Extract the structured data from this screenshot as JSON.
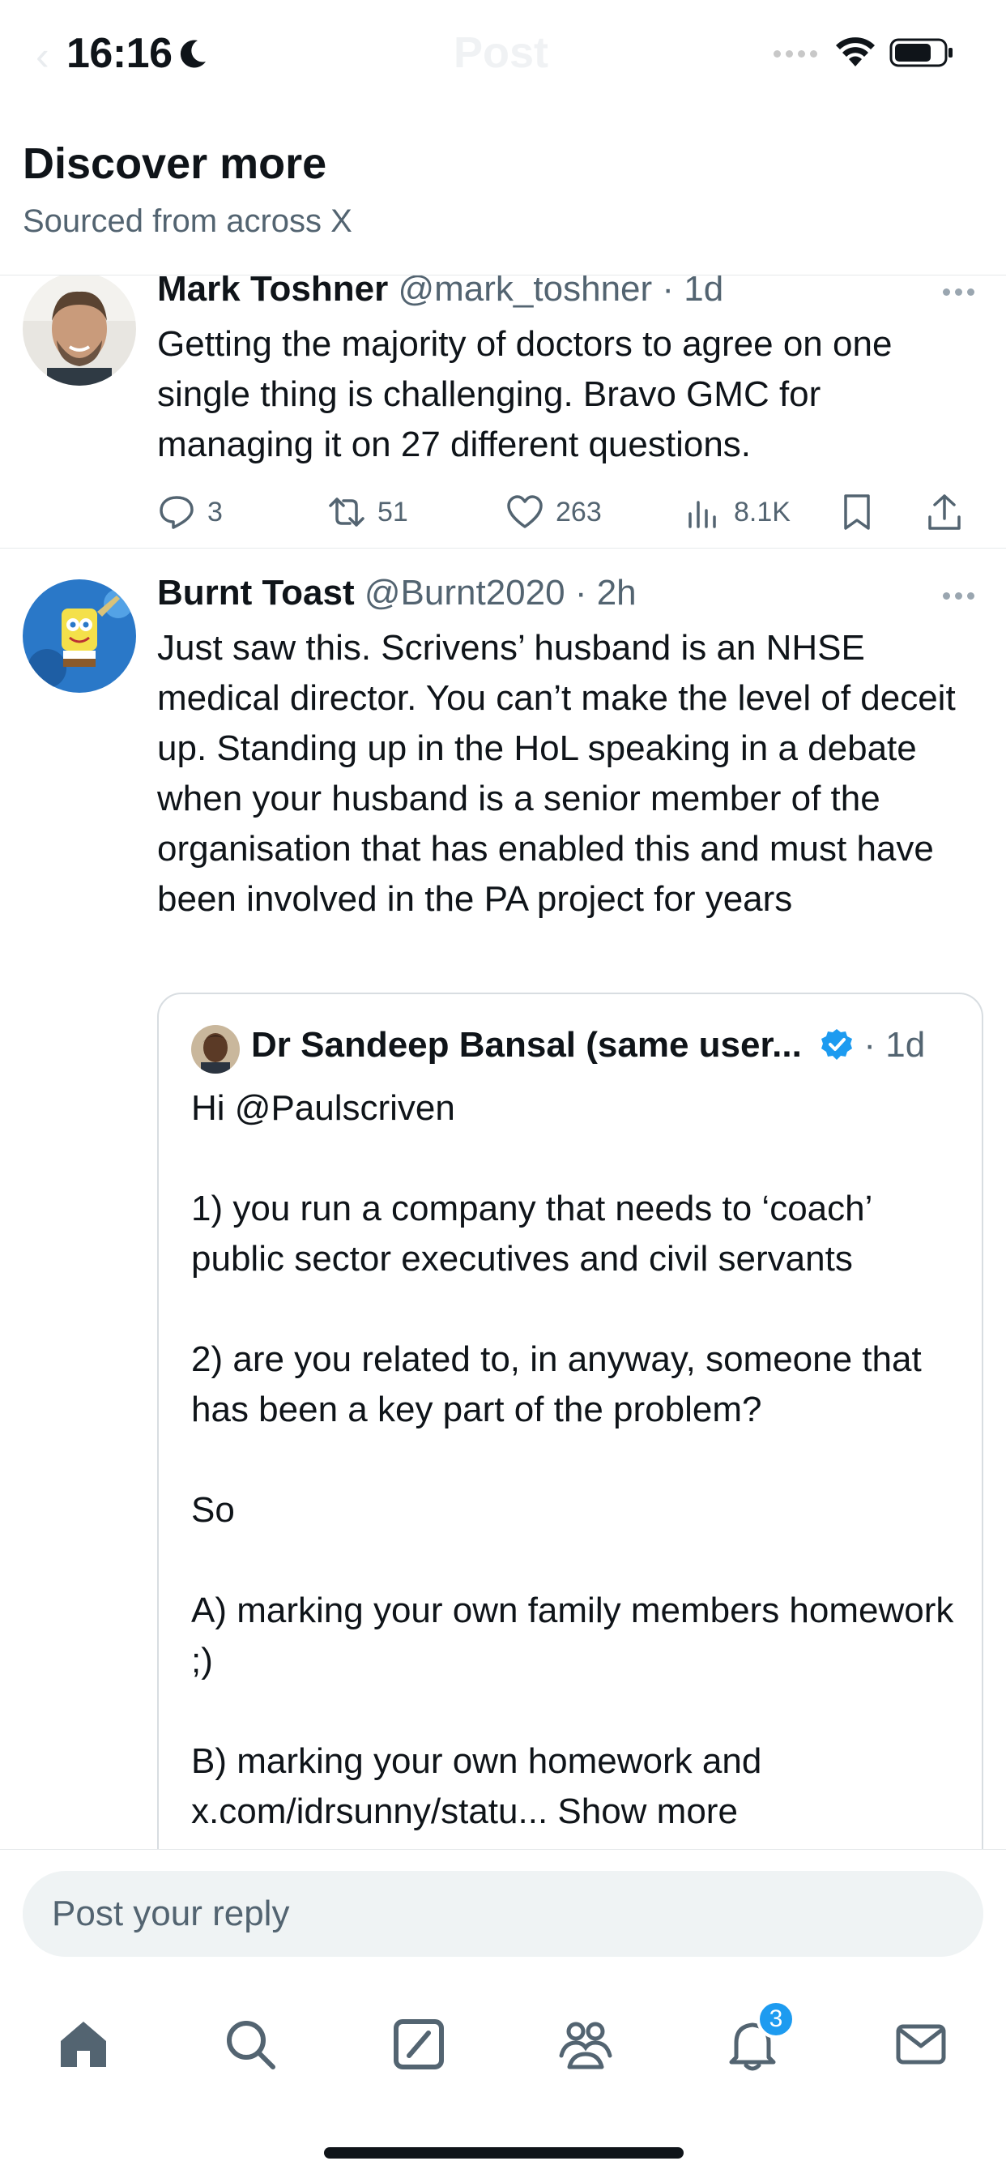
{
  "status_bar": {
    "time": "16:16",
    "ghost_title": "Post",
    "icons": [
      "moon-icon",
      "cellular-signal-icon",
      "wifi-icon",
      "battery-icon"
    ]
  },
  "header": {
    "title": "Discover more",
    "subtitle": "Sourced from across X"
  },
  "tweets": [
    {
      "name": "Mark Toshner",
      "handle": "@mark_toshner",
      "separator": "·",
      "time": "1d",
      "text": "Getting the majority of doctors to agree on one single thing is challenging. Bravo GMC for managing it on 27 different questions.",
      "replies": "3",
      "reposts": "51",
      "likes": "263",
      "views": "8.1K"
    },
    {
      "name": "Burnt Toast",
      "handle": "@Burnt2020",
      "separator": "·",
      "time": "2h",
      "text": "Just saw this. Scrivens’ husband is an NHSE medical director. You can’t make the level of deceit up. Standing up in the HoL speaking in a debate when your husband is a senior member of the organisation that has enabled this and must have been involved in the PA project for years",
      "quote": {
        "name": "Dr Sandeep Bansal (same user...",
        "separator": "·",
        "time": "1d",
        "text": "Hi @Paulscriven\n\n1) you run a company that needs to ‘coach’ public sector executives and civil servants\n\n2) are you related to, in anyway, someone that has been a key part of the problem?\n\nSo\n\nA) marking your own family members homework ;)\n\nB) marking your own homework and x.com/idrsunny/statu...",
        "show_more": " Show more"
      }
    }
  ],
  "reply": {
    "placeholder": "Post your reply"
  },
  "tab_bar": {
    "notifications_badge": "3",
    "tabs": [
      "home-icon",
      "search-icon",
      "grok-icon",
      "communities-icon",
      "notifications-icon",
      "messages-icon"
    ]
  },
  "colors": {
    "accent": "#1d9bf0",
    "text_primary": "#0f1419",
    "text_secondary": "#536471",
    "divider": "#e6e9eb"
  }
}
